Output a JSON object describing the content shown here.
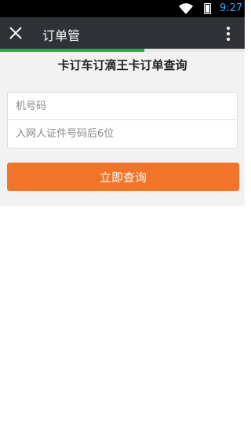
{
  "status_bar": {
    "time": "9:27",
    "icons": [
      "wifi-icon",
      "battery-icon"
    ]
  },
  "action_bar": {
    "title": "订单管",
    "icons": [
      "close-icon",
      "more-icon"
    ]
  },
  "progress": {
    "fraction": 0.59,
    "color": "#17b14f"
  },
  "page": {
    "heading": "卡订车订滴王卡订单查询",
    "form": {
      "phone_placeholder": "机号码",
      "id_placeholder": "入网人证件号码后6位",
      "submit_label": "立即查询"
    }
  },
  "colors": {
    "accent": "#f2742a",
    "topbar": "#2f3338",
    "progress": "#17b14f"
  }
}
